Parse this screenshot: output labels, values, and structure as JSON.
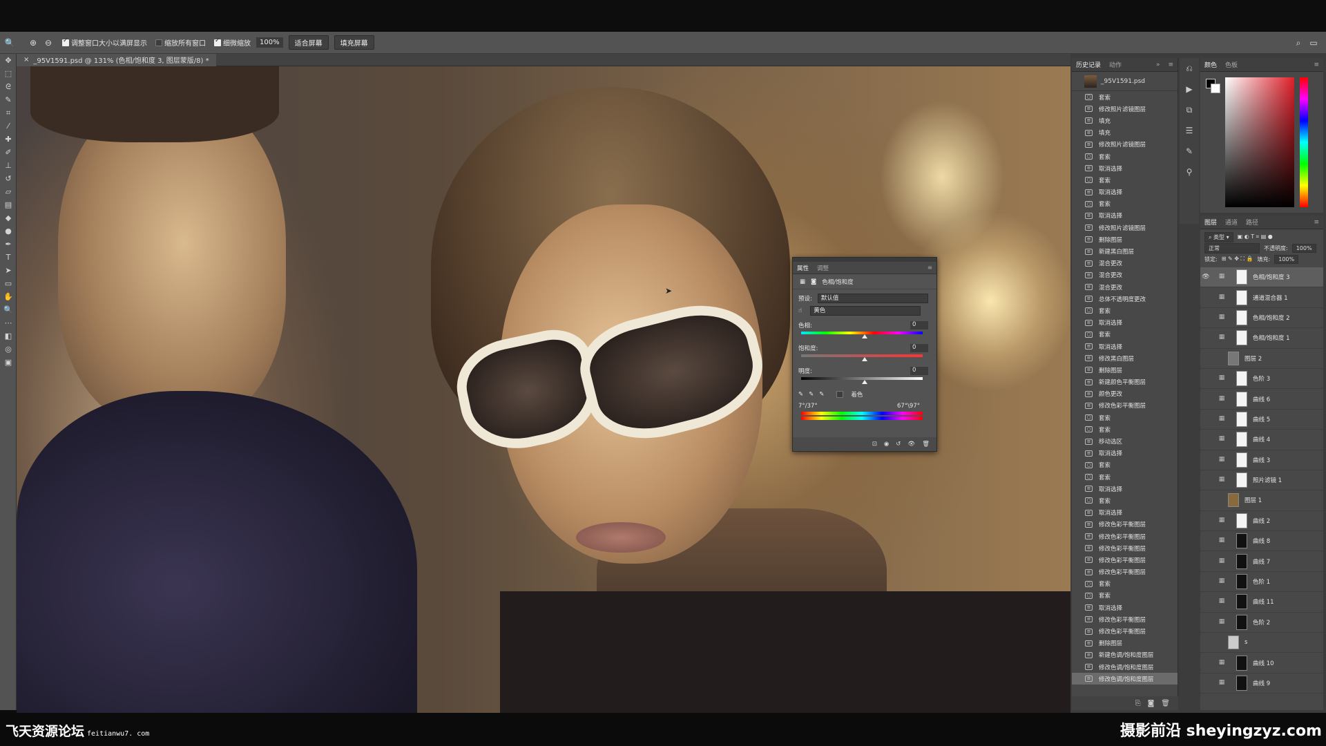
{
  "options_bar": {
    "checkbox1": "调整窗口大小以满屏显示",
    "checkbox2": "缩放所有窗口",
    "checkbox3": "细微缩放",
    "zoom": "100%",
    "btn_fit": "适合屏幕",
    "btn_fill": "填充屏幕"
  },
  "document_tab": {
    "title": "_95V1591.psd @ 131% (色相/饱和度 3, 图层蒙版/8) *"
  },
  "history": {
    "tab_history": "历史记录",
    "tab_actions": "动作",
    "snapshot": "_95V1591.psd",
    "items": [
      "套索",
      "修改照片滤镜图层",
      "填充",
      "填充",
      "修改照片滤镜图层",
      "套索",
      "取消选择",
      "套索",
      "取消选择",
      "套索",
      "取消选择",
      "修改照片滤镜图层",
      "删除图层",
      "新建黑白图层",
      "混合更改",
      "混合更改",
      "混合更改",
      "总体不透明度更改",
      "套索",
      "取消选择",
      "套索",
      "取消选择",
      "修改黑白图层",
      "删除图层",
      "新建颜色平衡图层",
      "颜色更改",
      "修改色彩平衡图层",
      "套索",
      "套索",
      "移动选区",
      "取消选择",
      "套索",
      "套索",
      "取消选择",
      "套索",
      "取消选择",
      "修改色彩平衡图层",
      "修改色彩平衡图层",
      "修改色彩平衡图层",
      "修改色彩平衡图层",
      "修改色彩平衡图层",
      "套索",
      "套索",
      "取消选择",
      "修改色彩平衡图层",
      "修改色彩平衡图层",
      "删除图层",
      "新建色调/饱和度图层",
      "修改色调/饱和度图层",
      "修改色调/饱和度图层"
    ]
  },
  "color_panel": {
    "tab_color": "颜色",
    "tab_swatches": "色板"
  },
  "layers_panel": {
    "tab_layers": "图层",
    "tab_channels": "通道",
    "tab_paths": "路径",
    "kind": "类型",
    "blend": "正常",
    "opacity_label": "不透明度:",
    "opacity": "100%",
    "lock_label": "锁定:",
    "fill_label": "填充:",
    "fill": "100%",
    "layers": [
      "色相/饱和度 3",
      "通道混合器 1",
      "色相/饱和度 2",
      "色相/饱和度 1",
      "图层 2",
      "色阶 3",
      "曲线 6",
      "曲线 5",
      "曲线 4",
      "曲线 3",
      "照片滤镜 1",
      "图层 1",
      "曲线 2",
      "曲线 8",
      "曲线 7",
      "色阶 1",
      "曲线 11",
      "色阶 2",
      "s",
      "曲线 10",
      "曲线 9"
    ]
  },
  "properties": {
    "tab_props": "属性",
    "tab_adjust": "调整",
    "title": "色相/饱和度",
    "preset_label": "预设:",
    "preset_value": "默认值",
    "channel_value": "黄色",
    "hue_label": "色相:",
    "hue": "0",
    "sat_label": "饱和度:",
    "sat": "0",
    "light_label": "明度:",
    "light": "0",
    "colorize": "着色",
    "range_left": "7°/37°",
    "range_right": "67°\\97°"
  },
  "watermark": {
    "left": "飞天资源论坛",
    "left_url": "feitianwu7. com",
    "right": "摄影前沿 sheyingzyz.com"
  }
}
